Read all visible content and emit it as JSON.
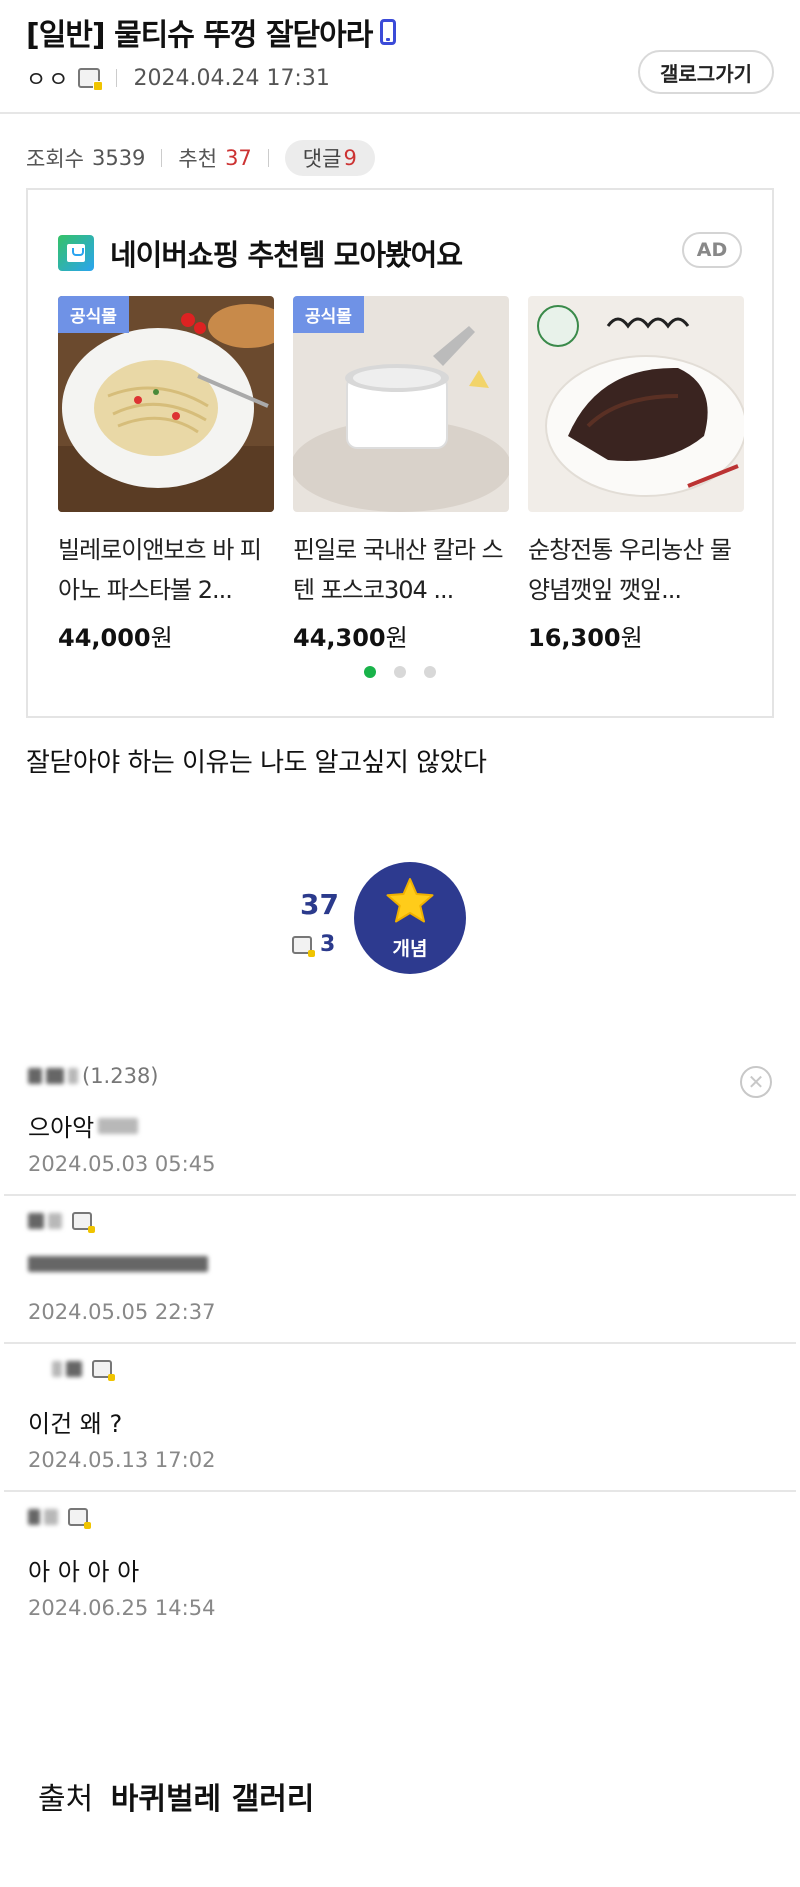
{
  "post": {
    "title": "[일반] 물티슈 뚜껑 잘닫아라",
    "author": "ㅇㅇ",
    "date": "2024.04.24 17:31",
    "gallery_button": "갤로그가기",
    "views_label": "조회수",
    "views": "3539",
    "reco_label": "추천",
    "reco": "37",
    "comment_label": "댓글",
    "comment_count": "9",
    "body": "잘닫아야 하는 이유는 나도 알고싶지 않았다"
  },
  "ad": {
    "title": "네이버쇼핑 추천템 모아봤어요",
    "badge": "AD",
    "products": [
      {
        "tag": "공식몰",
        "name": "빌레로이앤보흐 바 피아노 파스타볼 2...",
        "price": "44,000",
        "unit": "원"
      },
      {
        "tag": "공식몰",
        "name": "핀일로 국내산 칼라 스텐 포스코304 ...",
        "price": "44,300",
        "unit": "원"
      },
      {
        "tag": "",
        "name": "순창전통 우리농산 물 양념깻잎 깻잎...",
        "price": "16,300",
        "unit": "원"
      }
    ]
  },
  "recommend": {
    "count": "37",
    "gallery_count": "3",
    "button_label": "개념"
  },
  "comments": [
    {
      "user_suffix": "(1.238)",
      "text": "으아악 ",
      "date": "2024.05.03 05:45"
    },
    {
      "user_suffix": "",
      "text": "",
      "date": "2024.05.05 22:37"
    },
    {
      "user_suffix": "",
      "text": "이건 왜 ?",
      "date": "2024.05.13 17:02"
    },
    {
      "user_suffix": "",
      "text": "아 아 아 아",
      "date": "2024.06.25 14:54"
    }
  ],
  "source": {
    "label": "출처",
    "name": "바퀴벌레 갤러리"
  },
  "colors": {
    "accent_navy": "#2d3a8f",
    "recommend_red": "#cc3333",
    "official_tag": "#6f92e6",
    "active_dot": "#19b34a"
  }
}
